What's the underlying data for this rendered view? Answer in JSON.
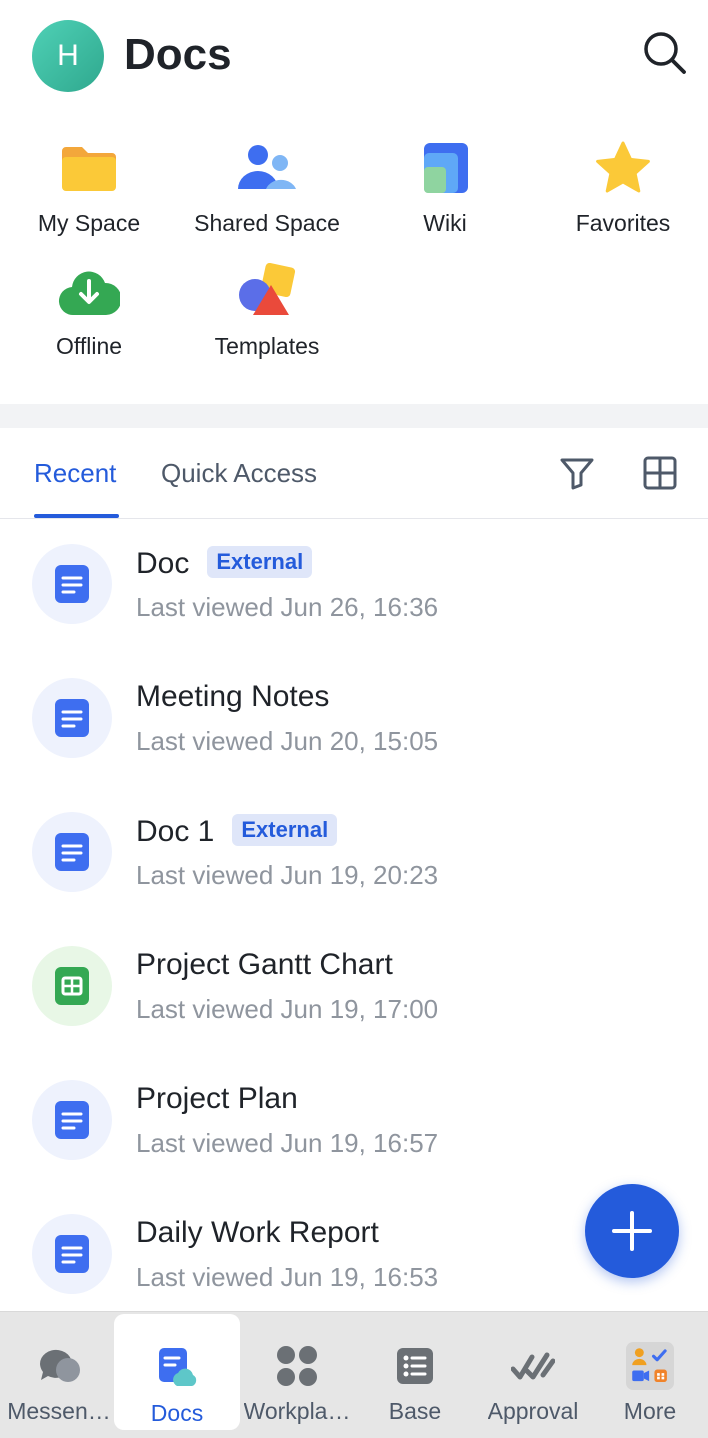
{
  "header": {
    "avatar_initial": "H",
    "title": "Docs"
  },
  "quick_entries": [
    {
      "label": "My Space",
      "icon": "folder-icon"
    },
    {
      "label": "Shared Space",
      "icon": "people-icon"
    },
    {
      "label": "Wiki",
      "icon": "wiki-icon"
    },
    {
      "label": "Favorites",
      "icon": "star-icon"
    },
    {
      "label": "Offline",
      "icon": "cloud-download-icon"
    },
    {
      "label": "Templates",
      "icon": "shapes-icon"
    }
  ],
  "tabs": [
    {
      "label": "Recent",
      "active": true
    },
    {
      "label": "Quick Access",
      "active": false
    }
  ],
  "files": [
    {
      "title": "Doc",
      "badge": "External",
      "meta_label": "Last viewed",
      "meta_time": "Jun 26, 16:36",
      "type": "doc"
    },
    {
      "title": "Meeting Notes",
      "badge": "",
      "meta_label": "Last viewed",
      "meta_time": "Jun 20, 15:05",
      "type": "doc"
    },
    {
      "title": "Doc 1",
      "badge": "External",
      "meta_label": "Last viewed",
      "meta_time": "Jun 19, 20:23",
      "type": "doc"
    },
    {
      "title": "Project Gantt Chart",
      "badge": "",
      "meta_label": "Last viewed",
      "meta_time": "Jun 19, 17:00",
      "type": "sheet"
    },
    {
      "title": "Project Plan",
      "badge": "",
      "meta_label": "Last viewed",
      "meta_time": "Jun 19, 16:57",
      "type": "doc"
    },
    {
      "title": "Daily Work Report",
      "badge": "",
      "meta_label": "Last viewed",
      "meta_time": "Jun 19, 16:53",
      "type": "doc"
    }
  ],
  "bottom_nav": [
    {
      "label": "Messen…",
      "icon": "messenger-icon",
      "active": false
    },
    {
      "label": "Docs",
      "icon": "docs-icon",
      "active": true
    },
    {
      "label": "Workpla…",
      "icon": "workplace-icon",
      "active": false
    },
    {
      "label": "Base",
      "icon": "base-icon",
      "active": false
    },
    {
      "label": "Approval",
      "icon": "approval-icon",
      "active": false
    },
    {
      "label": "More",
      "icon": "more-icon",
      "active": false
    }
  ],
  "colors": {
    "accent": "#245bdb",
    "doc_blue": "#3e6ef0",
    "sheet_green": "#34a853"
  }
}
